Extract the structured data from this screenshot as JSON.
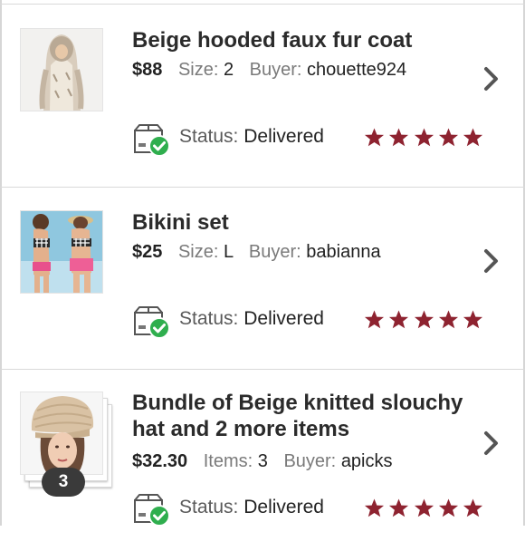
{
  "labels": {
    "size": "Size:",
    "buyer": "Buyer:",
    "items": "Items:",
    "status": "Status:"
  },
  "colors": {
    "star": "#8e2330",
    "delivered_badge": "#2fae4e",
    "chevron": "#555555"
  },
  "orders": [
    {
      "title": "Beige hooded faux fur coat",
      "price": "$88",
      "size": "2",
      "buyer": "chouette924",
      "status": "Delivered",
      "rating": 5,
      "thumbnail_icon": "faux-fur-coat-photo"
    },
    {
      "title": "Bikini set",
      "price": "$25",
      "size": "L",
      "buyer": "babianna",
      "status": "Delivered",
      "rating": 5,
      "thumbnail_icon": "bikini-set-photo"
    },
    {
      "title_line1": "Bundle of Beige knitted slouchy",
      "title_line2": "hat and 2 more items",
      "price": "$32.30",
      "items": "3",
      "buyer": "apicks",
      "status": "Delivered",
      "rating": 5,
      "bundle_count": "3",
      "thumbnail_icon": "slouchy-hat-photo"
    }
  ]
}
